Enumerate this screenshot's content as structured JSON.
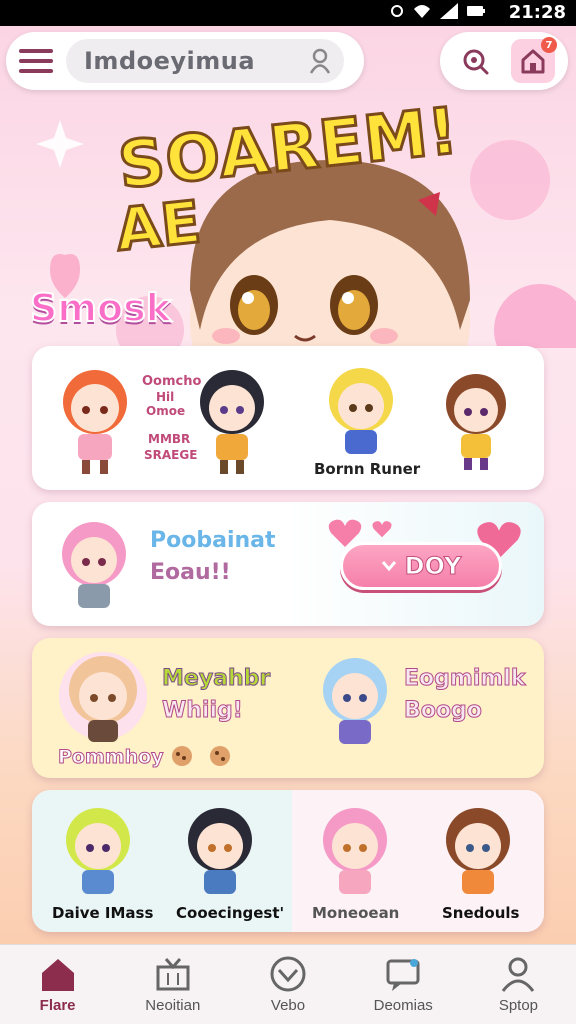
{
  "status_bar": {
    "time": "21:28"
  },
  "top_bar": {
    "search_text": "Imdoeyimua",
    "notification_count": "7"
  },
  "hero": {
    "title": "SOAREM!",
    "subtitle": "AE"
  },
  "section": {
    "label": "Smosk"
  },
  "cards": {
    "card1": {
      "text_a": "Oomcho",
      "text_b": "Hil",
      "text_c": "Omoe",
      "text_d": "MMBR",
      "text_e": "SRAEGE",
      "caption": "Bornn Runer"
    },
    "card2": {
      "line1": "Poobainat",
      "line2": "Eoau!!",
      "button_label": "DOY"
    },
    "card3": {
      "line1": "Meyahbr",
      "line2": "Whiig!",
      "line3": "Eogmimlk",
      "line4": "Boogo",
      "caption": "Pommhoy"
    },
    "card4": {
      "names": [
        "Daive IMass",
        "Cooecingest'",
        "Moneoean",
        "Snedouls"
      ]
    }
  },
  "bottom_nav": {
    "items": [
      "Flare",
      "Neoitian",
      "Vebo",
      "Deomias",
      "Sptop"
    ],
    "active": "Flare"
  },
  "colors": {
    "accent_pink": "#f57fa8",
    "title_yellow": "#ffe23a",
    "active_nav": "#8c2d4d"
  }
}
